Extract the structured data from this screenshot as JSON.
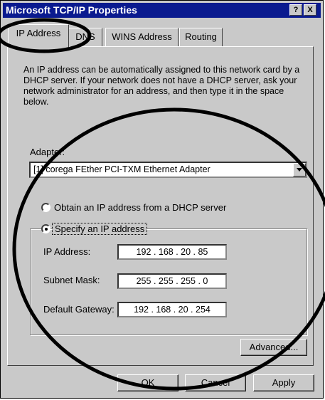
{
  "window": {
    "title": "Microsoft TCP/IP Properties",
    "help_btn": "?",
    "close_btn": "X"
  },
  "tabs": [
    {
      "label": "IP Address",
      "active": true
    },
    {
      "label": "DNS",
      "active": false
    },
    {
      "label": "WINS Address",
      "active": false
    },
    {
      "label": "Routing",
      "active": false
    }
  ],
  "ip_tab": {
    "description": "An IP address can be automatically assigned to this network card by a DHCP server.  If your network does not have a DHCP server, ask your network administrator for an address, and then type it in the space below.",
    "adapter_label": "Adapter:",
    "adapter_value": "[1] corega FEther PCI-TXM Ethernet Adapter",
    "radio_dhcp": "Obtain an IP address from a DHCP server",
    "radio_specify": "Specify an IP address",
    "ip_label": "IP Address:",
    "ip_value": "192 . 168 . 20 . 85",
    "subnet_label": "Subnet Mask:",
    "subnet_value": "255 . 255 . 255 . 0",
    "gateway_label": "Default Gateway:",
    "gateway_value": "192 . 168 . 20 . 254",
    "advanced_btn": "Advanced..."
  },
  "footer": {
    "ok": "OK",
    "cancel": "Cancel",
    "apply": "Apply"
  },
  "colors": {
    "titlebar": "#0a1a8f",
    "face": "#c9c9c9",
    "annotation": "#000000"
  }
}
